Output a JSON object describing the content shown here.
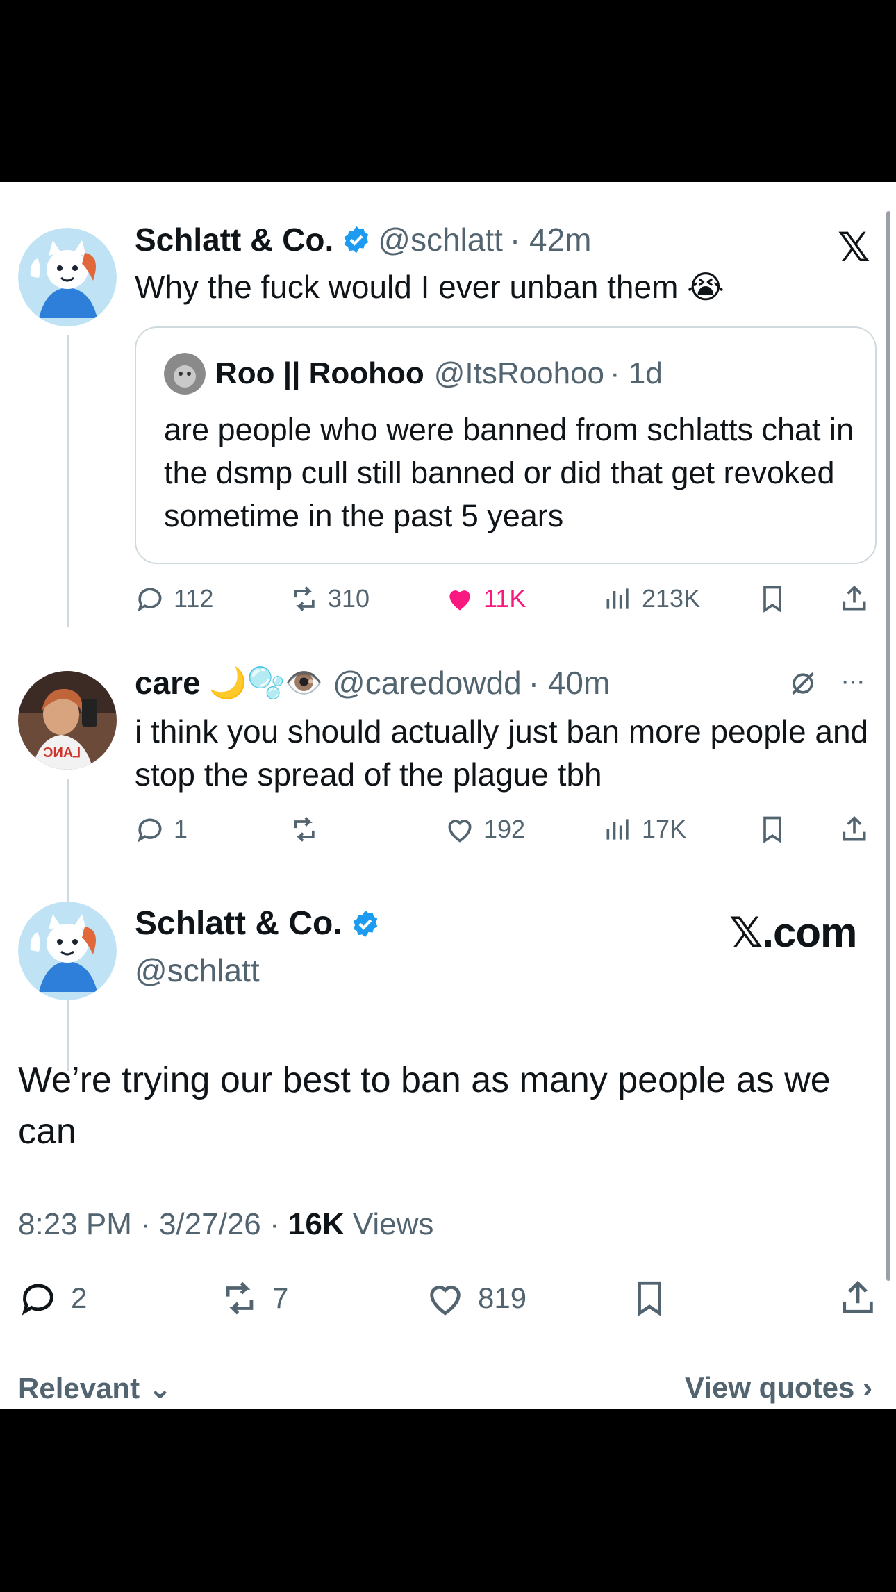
{
  "tweet1": {
    "name": "Schlatt & Co.",
    "handle": "@schlatt",
    "time": "· 42m",
    "text": "Why the fuck would I ever unban them 😭",
    "quote": {
      "name": "Roo || Roohoo",
      "handle": "@ItsRoohoo",
      "time": "· 1d",
      "text": "are people who were banned from schlatts chat in the dsmp cull still banned or did that get revoked sometime in the past 5 years"
    },
    "stats": {
      "replies": "112",
      "reposts": "310",
      "likes": "11K",
      "views": "213K"
    }
  },
  "tweet2": {
    "name": "care",
    "emoji": "🌙🫧👁️",
    "handle": "@caredowdd",
    "time": "· 40m",
    "text": "i think you should actually just ban more people and stop the spread of the plague tbh",
    "stats": {
      "replies": "1",
      "reposts": "",
      "likes": "192",
      "views": "17K"
    }
  },
  "tweet3": {
    "name": "Schlatt & Co.",
    "handle": "@schlatt",
    "watermark": "𝕏.com",
    "text": "We’re trying our best to ban as many people as we can",
    "timestamp": "8:23 PM · 3/27/26 · ",
    "views_count": "16K",
    "views_label": " Views",
    "stats": {
      "replies": "2",
      "reposts": "7",
      "likes": "819"
    }
  },
  "footer": {
    "sort_label": "Relevant ⌄",
    "view_quotes": "View quotes ›"
  },
  "colors": {
    "like_pink": "#f91880",
    "verified_blue": "#1d9bf0",
    "muted": "#536471"
  }
}
